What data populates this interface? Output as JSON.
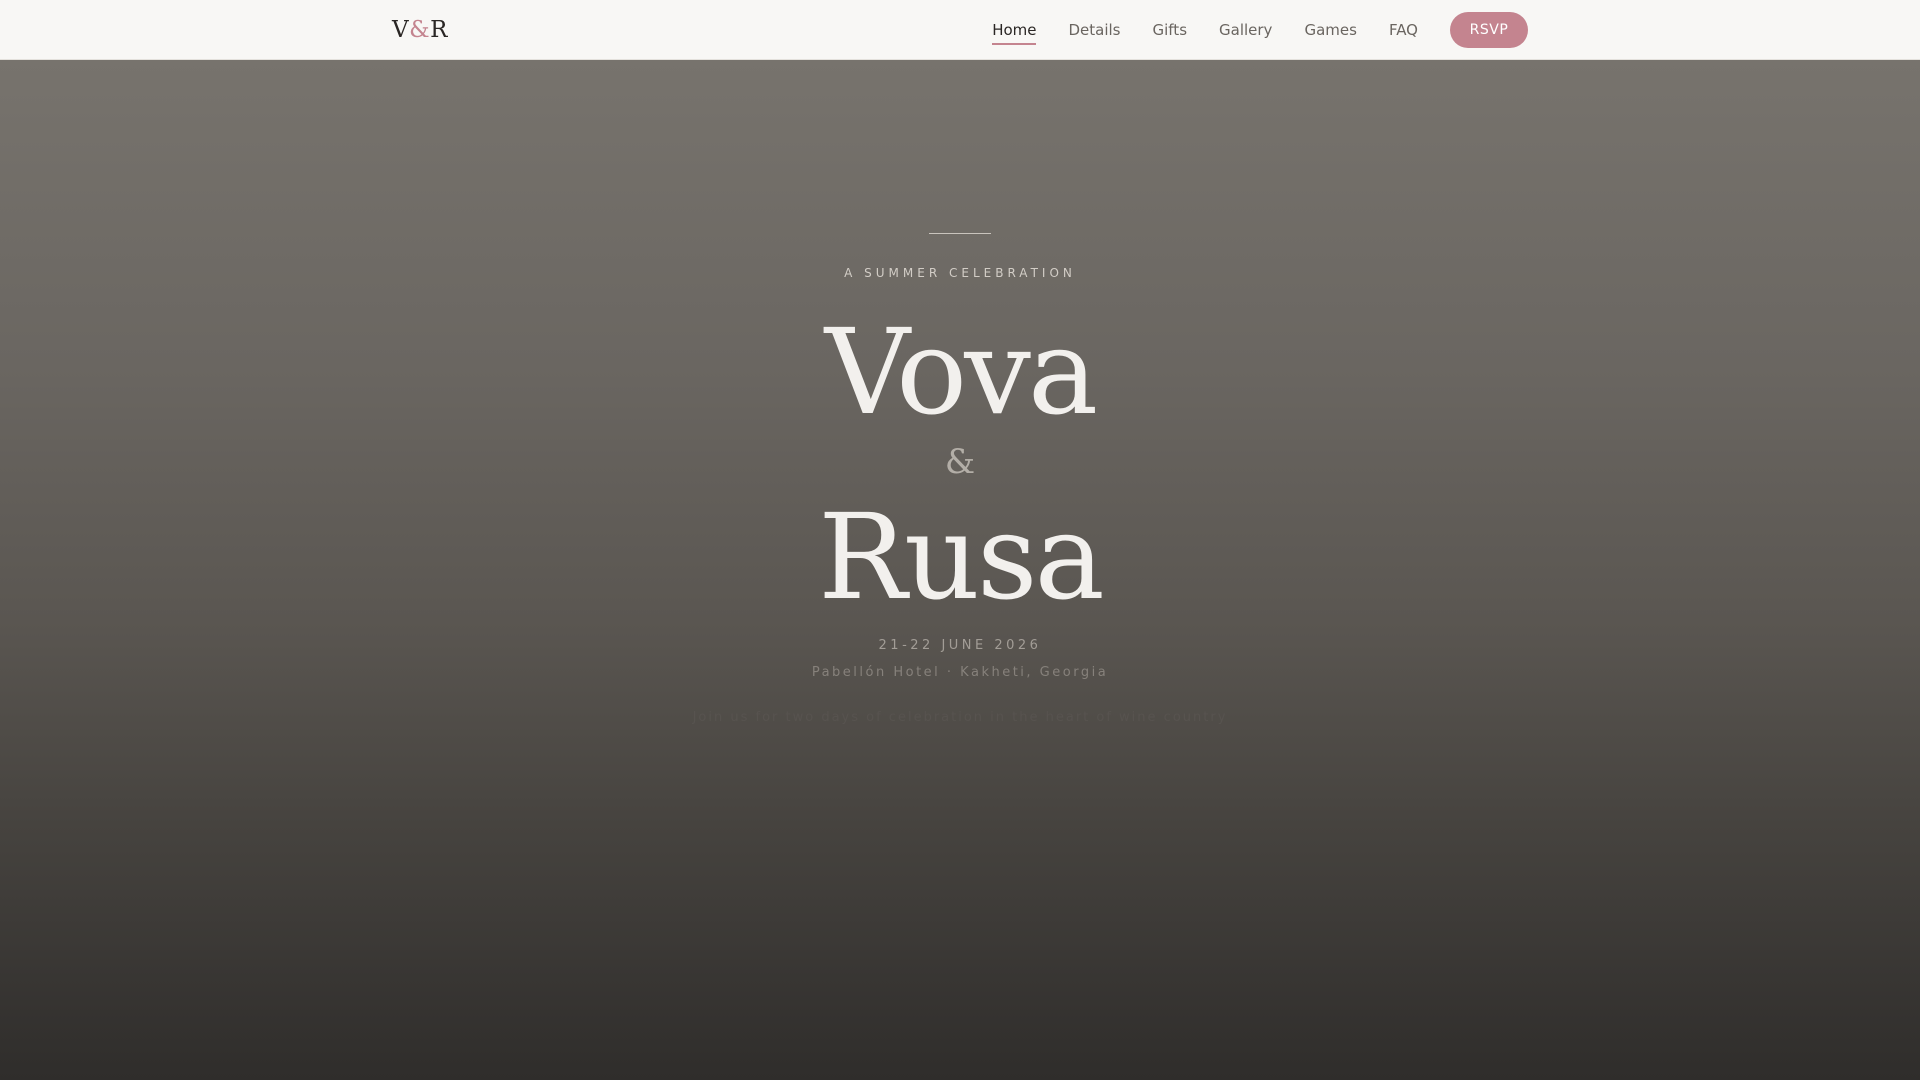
{
  "header": {
    "logo": {
      "first": "V",
      "amp": "&",
      "second": "R"
    },
    "nav": [
      {
        "label": "Home",
        "active": true
      },
      {
        "label": "Details"
      },
      {
        "label": "Gifts"
      },
      {
        "label": "Gallery"
      },
      {
        "label": "Games"
      },
      {
        "label": "FAQ"
      }
    ],
    "rsvp_label": "RSVP"
  },
  "hero": {
    "eyebrow": "A SUMMER CELEBRATION",
    "name_one": "Vova",
    "ampersand": "&",
    "name_two": "Rusa",
    "date": "21-22 JUNE 2026",
    "venue": "Pabellón Hotel · Kakheti, Georgia",
    "tagline": "Join us for two days of celebration in the heart of wine country"
  },
  "colors": {
    "accent": "#c4848f",
    "header_bg": "#f8f7f5",
    "hero_top": "#77736d",
    "hero_bottom": "#2f2d2b"
  }
}
